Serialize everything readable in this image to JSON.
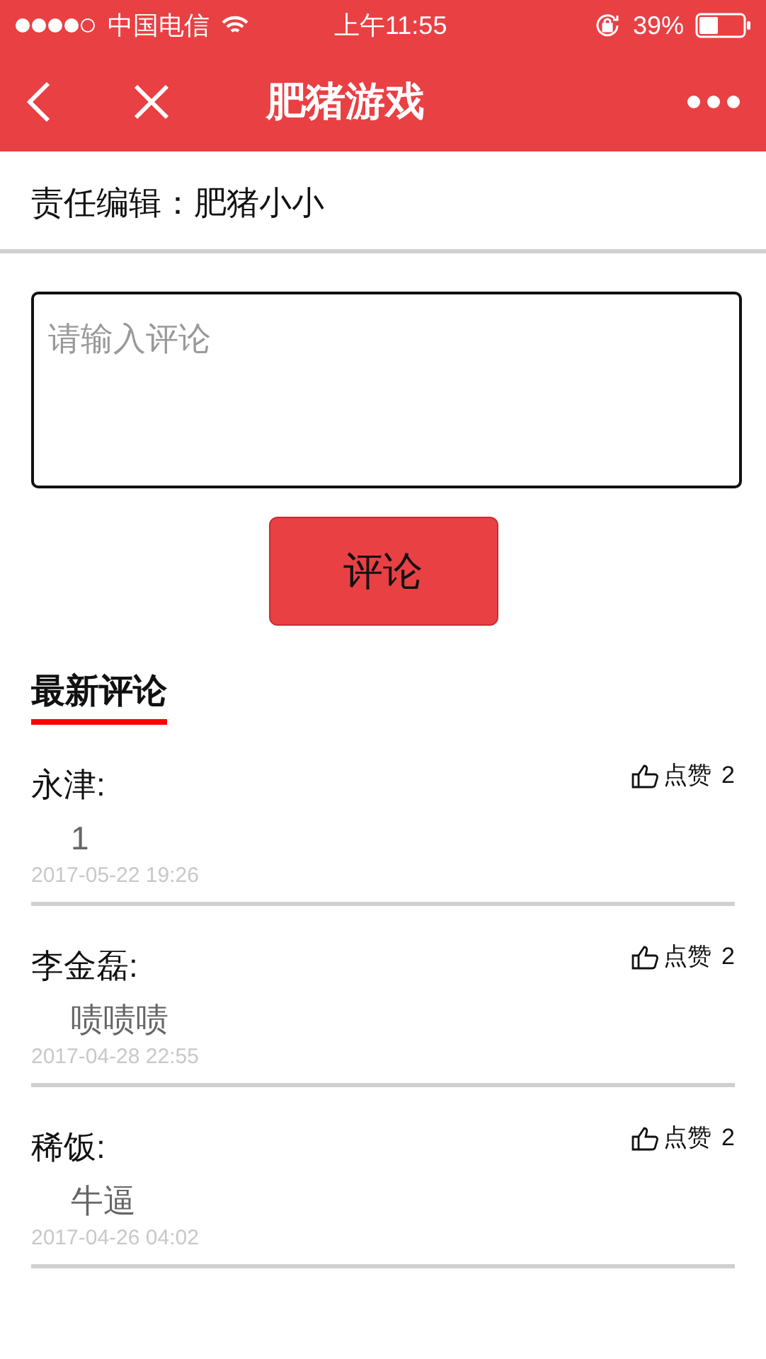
{
  "status_bar": {
    "carrier": "中国电信",
    "time": "上午11:55",
    "battery": "39%"
  },
  "nav": {
    "title": "肥猪游戏"
  },
  "article": {
    "editor": "责任编辑：肥猪小小"
  },
  "comment_box": {
    "placeholder": "请输入评论",
    "submit": "评论"
  },
  "latest": {
    "heading": "最新评论"
  },
  "comments": [
    {
      "author": "永津:",
      "like_label": "点赞",
      "likes": "2",
      "text": "1",
      "time": "2017-05-22 19:26"
    },
    {
      "author": "李金磊:",
      "like_label": "点赞",
      "likes": "2",
      "text": "啧啧啧",
      "time": "2017-04-28 22:55"
    },
    {
      "author": "稀饭:",
      "like_label": "点赞",
      "likes": "2",
      "text": "牛逼",
      "time": "2017-04-26 04:02"
    }
  ]
}
